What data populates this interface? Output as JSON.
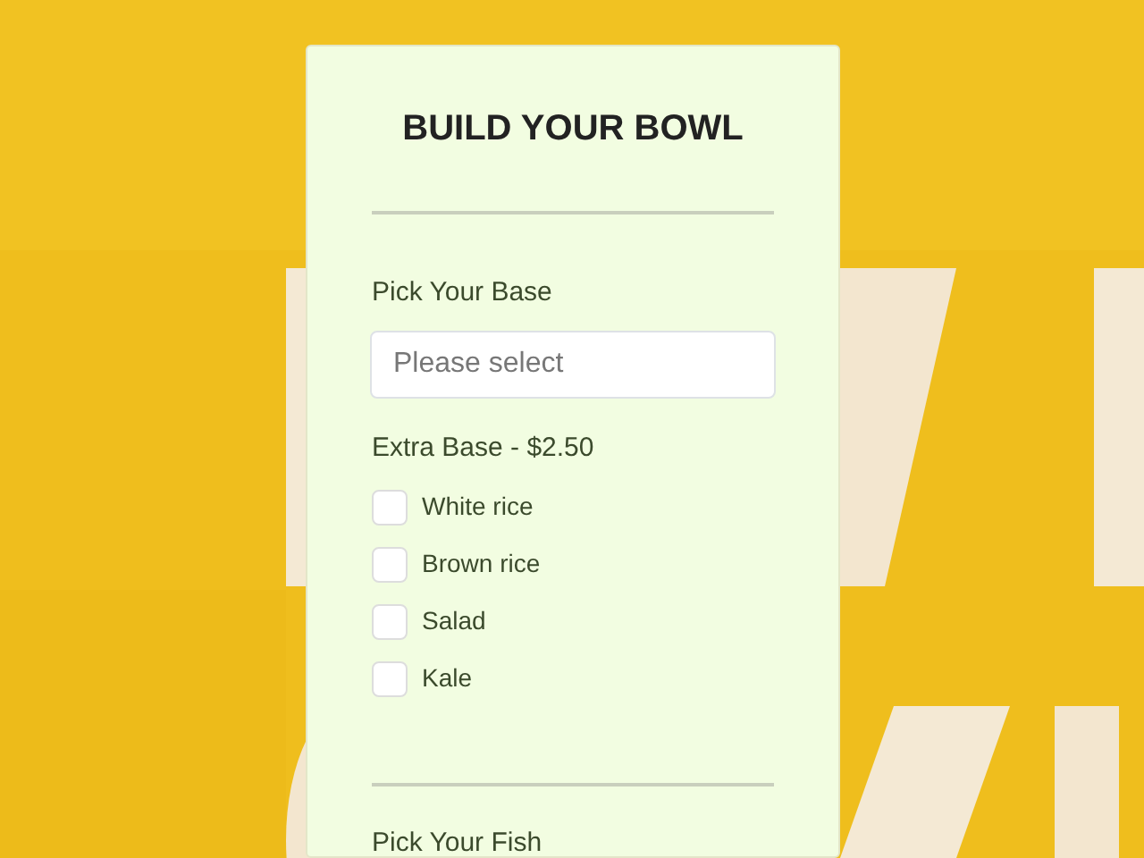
{
  "form": {
    "title": "BUILD YOUR BOWL",
    "base": {
      "label": "Pick Your Base",
      "placeholder": "Please select"
    },
    "extra_base": {
      "label": "Extra Base - $2.50",
      "options": [
        {
          "label": "White rice",
          "checked": false
        },
        {
          "label": "Brown rice",
          "checked": false
        },
        {
          "label": "Salad",
          "checked": false
        },
        {
          "label": "Kale",
          "checked": false
        }
      ]
    },
    "fish": {
      "label": "Pick Your Fish"
    }
  }
}
